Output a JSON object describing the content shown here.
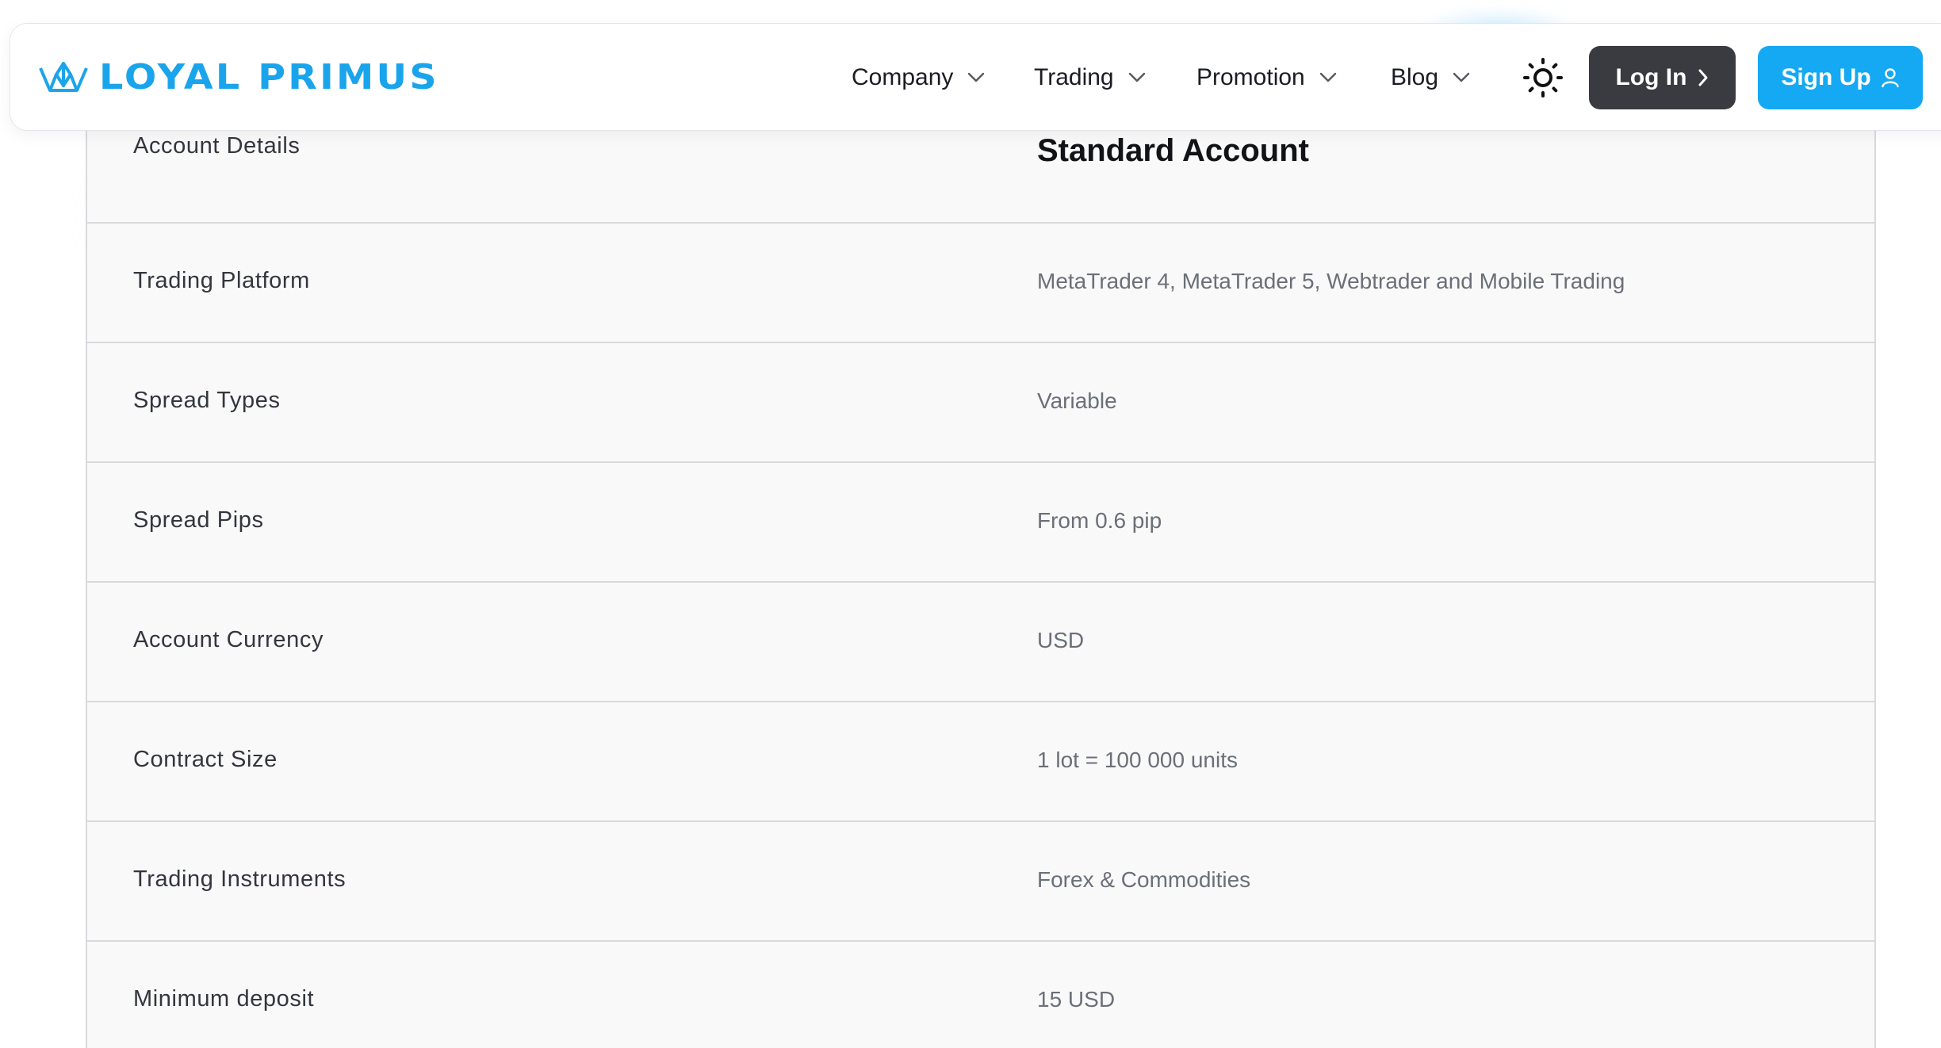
{
  "header": {
    "brand": "LOYAL PRIMUS",
    "nav": [
      {
        "label": "Company"
      },
      {
        "label": "Trading"
      },
      {
        "label": "Promotion"
      },
      {
        "label": "Blog"
      }
    ],
    "login_label": "Log In",
    "signup_label": "Sign Up",
    "icons": {
      "logo": "crown-logo-icon",
      "chevron": "chevron-down-icon",
      "theme": "sun-icon",
      "login": "chevron-right-icon",
      "signup": "user-icon"
    }
  },
  "table": {
    "header_label": "Account Details",
    "header_value": "Standard Account",
    "rows": [
      {
        "label": "Trading Platform",
        "value": "MetaTrader 4, MetaTrader 5, Webtrader and Mobile Trading"
      },
      {
        "label": "Spread Types",
        "value": "Variable"
      },
      {
        "label": "Spread Pips",
        "value": "From 0.6 pip"
      },
      {
        "label": "Account Currency",
        "value": "USD"
      },
      {
        "label": "Contract Size",
        "value": "1 lot = 100 000 units"
      },
      {
        "label": "Trading Instruments",
        "value": "Forex & Commodities"
      },
      {
        "label": "Minimum deposit",
        "value": "15 USD"
      }
    ]
  },
  "colors": {
    "brand": "#1aa4ec",
    "signup_bg": "#14a9f2",
    "login_bg": "#3a3b40",
    "table_bg": "#f9f9f9",
    "border": "#d8d9dc"
  }
}
